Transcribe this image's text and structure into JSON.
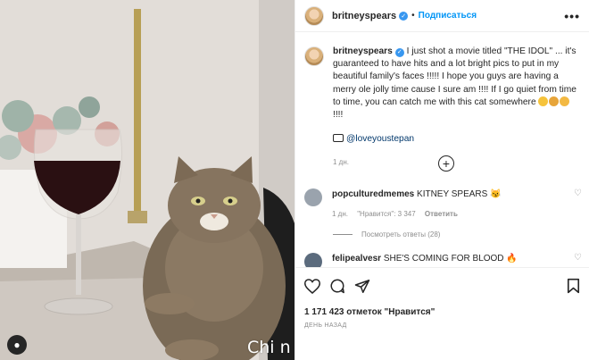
{
  "post": {
    "username": "britneyspears",
    "verified_glyph": "✓",
    "follow_label": "Подписаться",
    "dot": "•",
    "more_glyph": "•••"
  },
  "caption": {
    "username": "britneyspears",
    "text_1": " I just shot a movie titled \"THE IDOL\" ... it's guaranteed to have hits and a lot bright pics to put in my beautiful family's faces !!!!! I hope you guys are having a merry ole jolly time cause I sure am !!!! If I go quiet from time to time, you can catch me with this cat somewhere ",
    "text_end": " !!!!",
    "credit_mention": "@loveyoustepan",
    "time": "1 дн."
  },
  "comments": [
    {
      "username": "popculturedmemes",
      "text": " KITNEY SPEARS 😼",
      "time": "1 дн.",
      "likes": "\"Нравится\": 3 347",
      "reply_label": "Ответить",
      "view_replies": "Посмотреть ответы (28)"
    },
    {
      "username": "felipealvesr",
      "text": " SHE'S COMING FOR BLOOD 🔥"
    }
  ],
  "actions": {
    "likes": "1 171 423 отметок \"Нравится\"",
    "time": "ДЕНЬ НАЗАД"
  },
  "watermark": "Chi n",
  "icons": {
    "heart": "heart-icon",
    "comment": "comment-icon",
    "share": "share-icon",
    "bookmark": "bookmark-icon",
    "add": "add-comment-icon"
  },
  "colors": {
    "accent": "#0095f6",
    "verified": "#3897f0",
    "muted": "#8e8e8e"
  }
}
